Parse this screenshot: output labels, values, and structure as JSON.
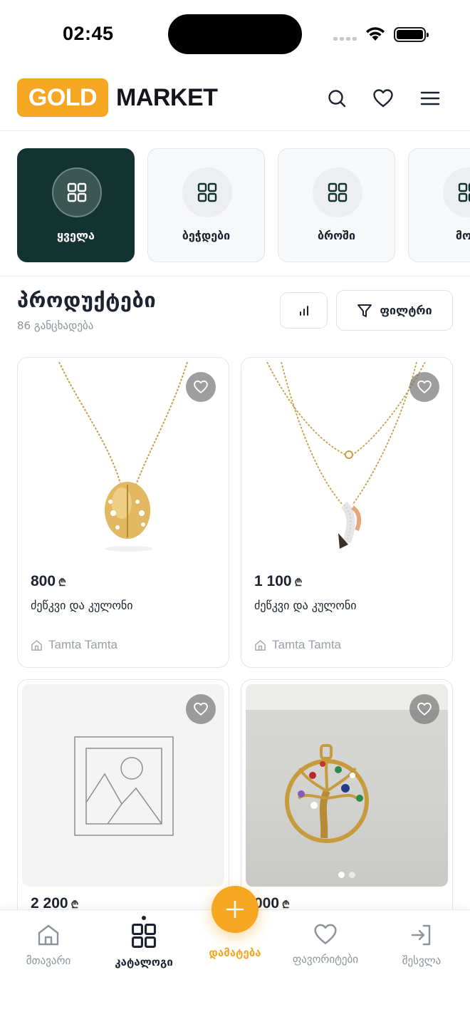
{
  "status_bar": {
    "time": "02:45"
  },
  "header": {
    "logo_primary": "GOLD",
    "logo_secondary": "MARKET",
    "accent_color": "#f5a623",
    "dark_color": "#12332f"
  },
  "categories": [
    {
      "label": "ყველა",
      "active": true
    },
    {
      "label": "ბეჭდები",
      "active": false
    },
    {
      "label": "ბროში",
      "active": false
    },
    {
      "label": "მონ",
      "active": false
    }
  ],
  "products_section": {
    "title": "პროდუქტები",
    "count": "86 განცხადება",
    "filter_label": "ფილტრი"
  },
  "products": [
    {
      "price": "800",
      "currency": "₾",
      "name": "ძეწკვი და კულონი",
      "seller": "Tamta Tamta"
    },
    {
      "price": "1 100",
      "currency": "₾",
      "name": "ძეწკვი და კულონი",
      "seller": "Tamta Tamta"
    },
    {
      "price": "2 200",
      "currency": "₾"
    },
    {
      "price": "000",
      "currency": "₾"
    }
  ],
  "bottom_nav": {
    "home": "მთავარი",
    "catalog": "კატალოგი",
    "add": "დამატება",
    "favorites": "ფავორიტები",
    "login": "შესვლა"
  }
}
